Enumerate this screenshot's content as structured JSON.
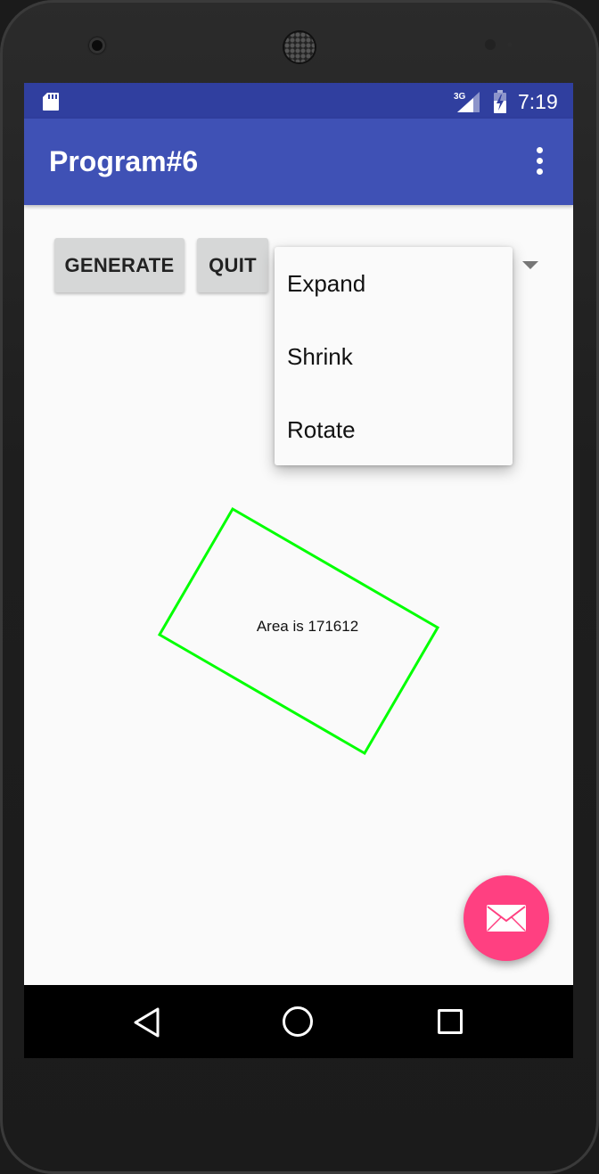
{
  "status_bar": {
    "time": "7:19",
    "network_label": "3G",
    "icons": [
      "sd-card-icon",
      "signal-3g-icon",
      "battery-charging-icon"
    ]
  },
  "app_bar": {
    "title": "Program#6",
    "menu_icon": "overflow-menu-icon"
  },
  "buttons": {
    "generate": "GENERATE",
    "quit": "QUIT"
  },
  "spinner_menu": {
    "items": [
      "Expand",
      "Shrink",
      "Rotate"
    ]
  },
  "canvas": {
    "area_text": "Area is 171612",
    "shape_color": "#00ff00"
  },
  "fab": {
    "icon": "email-icon",
    "color": "#ff4081"
  },
  "nav_bar": {
    "icons": [
      "back-icon",
      "home-icon",
      "recents-icon"
    ]
  },
  "colors": {
    "status_bar": "#303f9f",
    "app_bar": "#3f51b5",
    "accent": "#ff4081",
    "shape": "#00ff00"
  }
}
